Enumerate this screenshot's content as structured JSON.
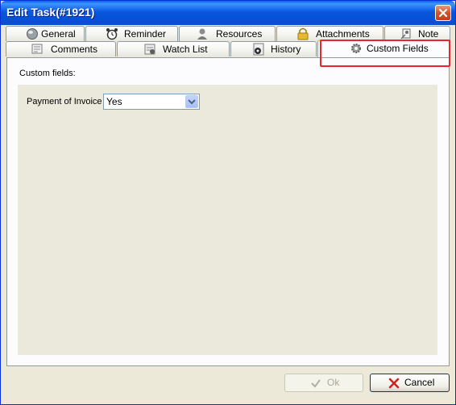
{
  "window": {
    "title": "Edit Task(#1921)"
  },
  "tabs_row1": [
    {
      "label": "General",
      "icon": "globe-icon"
    },
    {
      "label": "Reminder",
      "icon": "alarm-clock-icon"
    },
    {
      "label": "Resources",
      "icon": "user-icon"
    },
    {
      "label": "Attachments",
      "icon": "lock-icon"
    },
    {
      "label": "Note",
      "icon": "pin-icon"
    }
  ],
  "tabs_row2": [
    {
      "label": "Comments",
      "icon": "comments-icon"
    },
    {
      "label": "Watch List",
      "icon": "watch-list-icon"
    },
    {
      "label": "History",
      "icon": "history-icon"
    },
    {
      "label": "Custom Fields",
      "icon": "gear-icon",
      "active": true
    }
  ],
  "custom_fields": {
    "heading": "Custom fields:",
    "field_label": "Payment of Invoice",
    "field_value": "Yes"
  },
  "buttons": {
    "ok": "Ok",
    "cancel": "Cancel"
  },
  "colors": {
    "highlight": "#E8262C",
    "title_bar": "#0A58E0",
    "dialog_bg": "#ECE9D8"
  }
}
